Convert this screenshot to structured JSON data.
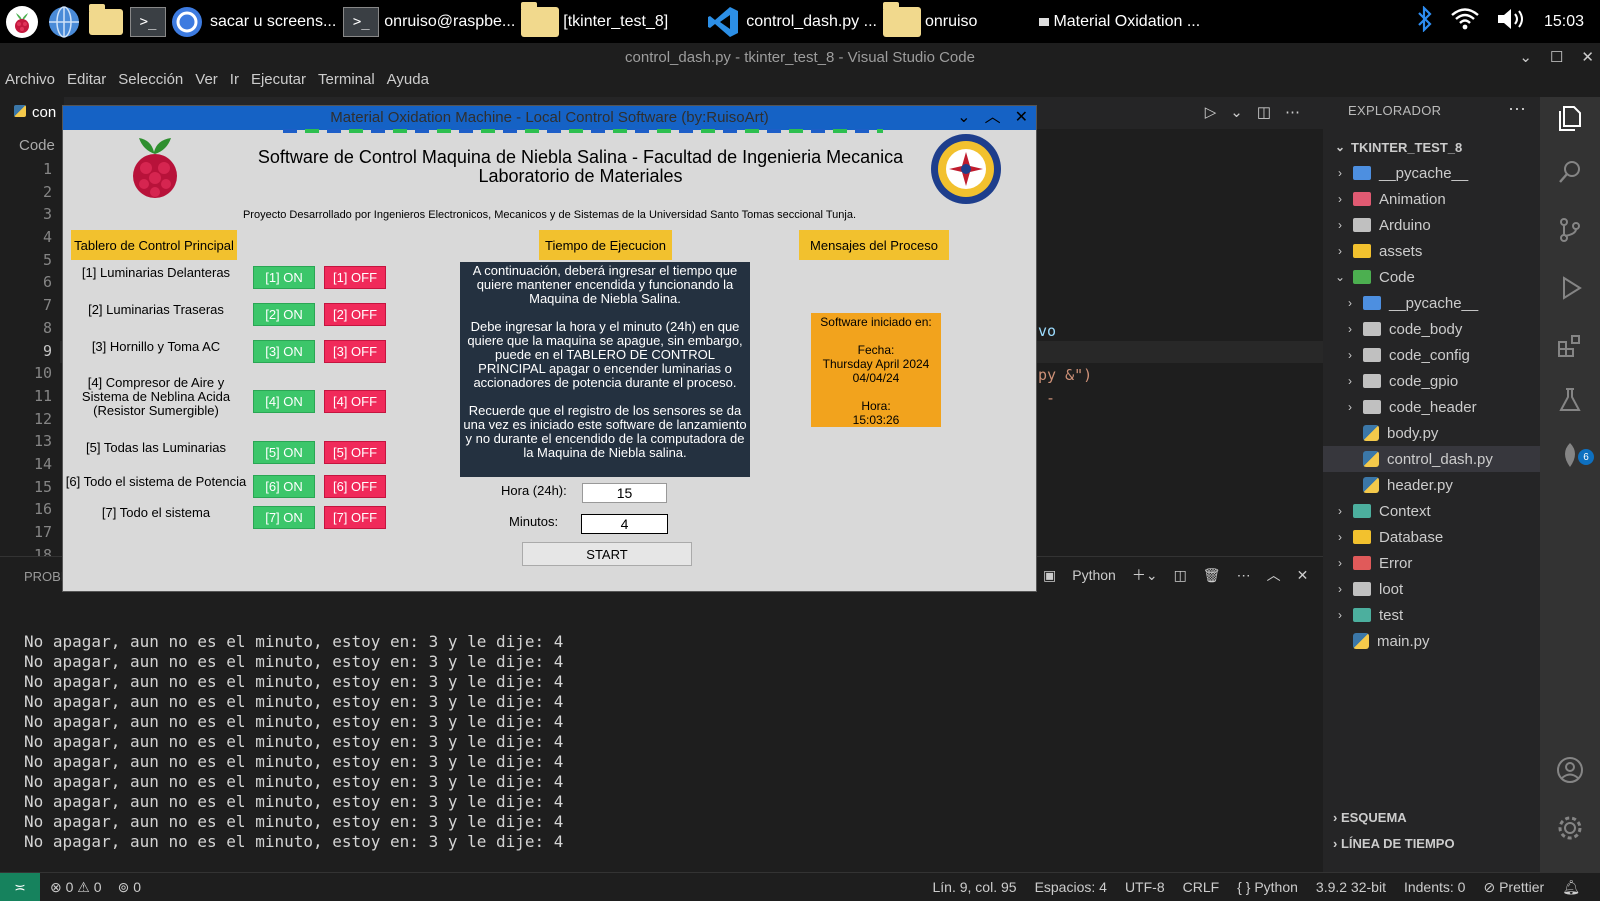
{
  "taskbar": {
    "tasks": [
      {
        "label": "sacar u screens..."
      },
      {
        "label": "onruiso@raspbe..."
      },
      {
        "label": "[tkinter_test_8]"
      },
      {
        "label": "control_dash.py ..."
      },
      {
        "label": "onruiso"
      },
      {
        "label": "Material Oxidation ..."
      }
    ],
    "clock": "15:03"
  },
  "vscode": {
    "title": "control_dash.py - tkinter_test_8 - Visual Studio Code",
    "menu": [
      "Archivo",
      "Editar",
      "Selección",
      "Ver",
      "Ir",
      "Ejecutar",
      "Terminal",
      "Ayuda"
    ],
    "tab_label": "con",
    "breadcrumb": "Code",
    "line_numbers": [
      "1",
      "2",
      "3",
      "4",
      "5",
      "6",
      "7",
      "8",
      "9",
      "10",
      "11",
      "12",
      "13",
      "14",
      "15",
      "16",
      "17",
      "18"
    ],
    "code_fragments": [
      "vo",
      "py &\")",
      "-"
    ],
    "panel_tab": "PROBL",
    "panel_shell": "Python",
    "terminal_lines": [
      "No apagar, aun no es el minuto, estoy en: 3 y le dije: 4",
      "No apagar, aun no es el minuto, estoy en: 3 y le dije: 4",
      "No apagar, aun no es el minuto, estoy en: 3 y le dije: 4",
      "No apagar, aun no es el minuto, estoy en: 3 y le dije: 4",
      "No apagar, aun no es el minuto, estoy en: 3 y le dije: 4",
      "No apagar, aun no es el minuto, estoy en: 3 y le dije: 4",
      "No apagar, aun no es el minuto, estoy en: 3 y le dije: 4",
      "No apagar, aun no es el minuto, estoy en: 3 y le dije: 4",
      "No apagar, aun no es el minuto, estoy en: 3 y le dije: 4",
      "No apagar, aun no es el minuto, estoy en: 3 y le dije: 4",
      "No apagar, aun no es el minuto, estoy en: 3 y le dije: 4"
    ]
  },
  "explorer": {
    "header": "EXPLORADOR",
    "root": "TKINTER_TEST_8",
    "items": [
      {
        "label": "__pycache__",
        "kind": "folder",
        "color": "#4d8fe0"
      },
      {
        "label": "Animation",
        "kind": "folder",
        "color": "#e05a72"
      },
      {
        "label": "Arduino",
        "kind": "folder",
        "color": "#c0c0c0"
      },
      {
        "label": "assets",
        "kind": "folder",
        "color": "#f2c12e"
      },
      {
        "label": "Code",
        "kind": "folder-open",
        "color": "#4caf50"
      },
      {
        "label": "__pycache__",
        "kind": "folder",
        "color": "#4d8fe0"
      },
      {
        "label": "code_body",
        "kind": "folder",
        "color": "#c0c0c0"
      },
      {
        "label": "code_config",
        "kind": "folder",
        "color": "#c0c0c0"
      },
      {
        "label": "code_gpio",
        "kind": "folder",
        "color": "#c0c0c0"
      },
      {
        "label": "code_header",
        "kind": "folder",
        "color": "#c0c0c0"
      },
      {
        "label": "body.py",
        "kind": "py"
      },
      {
        "label": "control_dash.py",
        "kind": "py",
        "selected": true
      },
      {
        "label": "header.py",
        "kind": "py"
      },
      {
        "label": "Context",
        "kind": "folder",
        "color": "#4caf9e"
      },
      {
        "label": "Database",
        "kind": "folder",
        "color": "#f2c12e"
      },
      {
        "label": "Error",
        "kind": "folder",
        "color": "#e05a5a"
      },
      {
        "label": "loot",
        "kind": "folder",
        "color": "#c0c0c0"
      },
      {
        "label": "test",
        "kind": "folder",
        "color": "#4caf9e"
      },
      {
        "label": "main.py",
        "kind": "py"
      }
    ],
    "outline": "ESQUEMA",
    "timeline": "LÍNEA DE TIEMPO",
    "extensions_badge": "6"
  },
  "statusbar": {
    "errors": "0",
    "warnings": "0",
    "ports": "0",
    "position": "Lín. 9, col. 95",
    "spaces": "Espacios: 4",
    "encoding": "UTF-8",
    "eol": "CRLF",
    "language": "Python",
    "interpreter": "3.9.2 32-bit",
    "indents": "Indents: 0",
    "formatter": "Prettier"
  },
  "tkapp": {
    "window_title": "Material Oxidation Machine - Local Control Software (by:RuisoArt)",
    "header_line1": "Software de Control Maquina de Niebla Salina - Facultad de Ingenieria Mecanica",
    "header_line2": "Laboratorio de Materiales",
    "subtitle": "Proyecto Desarrollado por Ingenieros Electronicos, Mecanicos y de Sistemas de la Universidad Santo Tomas seccional Tunja.",
    "panel_control": "Tablero de Control Principal",
    "panel_time": "Tiempo de Ejecucion",
    "panel_messages": "Mensajes del Proceso",
    "rows": [
      {
        "label": "[1] Luminarias Delanteras",
        "on": "[1] ON",
        "off": "[1] OFF"
      },
      {
        "label": "[2] Luminarias Traseras",
        "on": "[2] ON",
        "off": "[2] OFF"
      },
      {
        "label": "[3] Hornillo y Toma AC",
        "on": "[3] ON",
        "off": "[3] OFF"
      },
      {
        "label": "[4] Compresor de Aire y Sistema de Neblina Acida (Resistor Sumergible)",
        "on": "[4] ON",
        "off": "[4] OFF"
      },
      {
        "label": "[5] Todas las Luminarias",
        "on": "[5] ON",
        "off": "[5] OFF"
      },
      {
        "label": "[6] Todo el sistema de Potencia",
        "on": "[6] ON",
        "off": "[6] OFF"
      },
      {
        "label": "[7] Todo el sistema",
        "on": "[7] ON",
        "off": "[7] OFF"
      }
    ],
    "info_p1": "A continuación, deberá ingresar el tiempo que quiere mantener encendida y funcionando la Maquina de Niebla Salina.",
    "info_p2": "Debe ingresar la hora y el minuto (24h) en que quiere que la maquina se apague, sin embargo, puede en el TABLERO DE CONTROL PRINCIPAL apagar o encender luminarias o accionadores de potencia durante el proceso.",
    "info_p3": "Recuerde que el registro de los sensores se da una vez es iniciado este software de lanzamiento y no durante el encendido de la computadora de la Maquina de Niebla salina.",
    "hour_label": "Hora (24h):",
    "hour_value": "15",
    "minute_label": "Minutos:",
    "minute_value": "4",
    "start_label": "START",
    "msg_started": "Software iniciado en:",
    "msg_date_label": "Fecha:",
    "msg_date_long": "Thursday April 2024",
    "msg_date_short": "04/04/24",
    "msg_time_label": "Hora:",
    "msg_time": "15:03:26"
  }
}
